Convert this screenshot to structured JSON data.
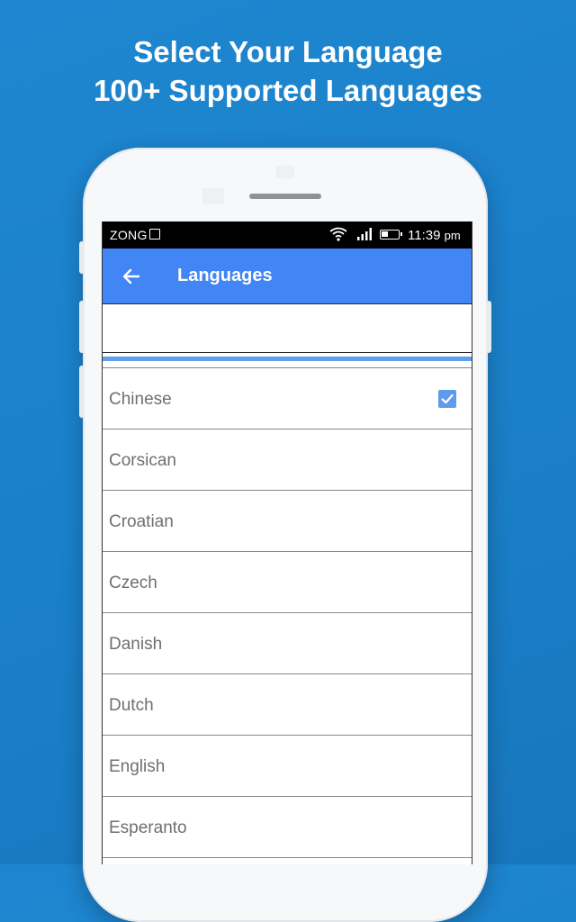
{
  "promo": {
    "line1": "Select Your Language",
    "line2": "100+ Supported Languages"
  },
  "status_bar": {
    "carrier": "ZONG",
    "time": "11:39",
    "ampm": "pm"
  },
  "toolbar": {
    "title": "Languages",
    "back_icon": "arrow-left-icon"
  },
  "search": {
    "value": "",
    "placeholder": ""
  },
  "languages": [
    {
      "label": "Chinese",
      "checked": true
    },
    {
      "label": "Corsican",
      "checked": false
    },
    {
      "label": "Croatian",
      "checked": false
    },
    {
      "label": "Czech",
      "checked": false
    },
    {
      "label": "Danish",
      "checked": false
    },
    {
      "label": "Dutch",
      "checked": false
    },
    {
      "label": "English",
      "checked": false
    },
    {
      "label": "Esperanto",
      "checked": false
    }
  ],
  "colors": {
    "background": "#1a7fc8",
    "toolbar": "#4285f4",
    "checkbox": "#5e9bec",
    "accent_bar": "#5fa0ee"
  }
}
